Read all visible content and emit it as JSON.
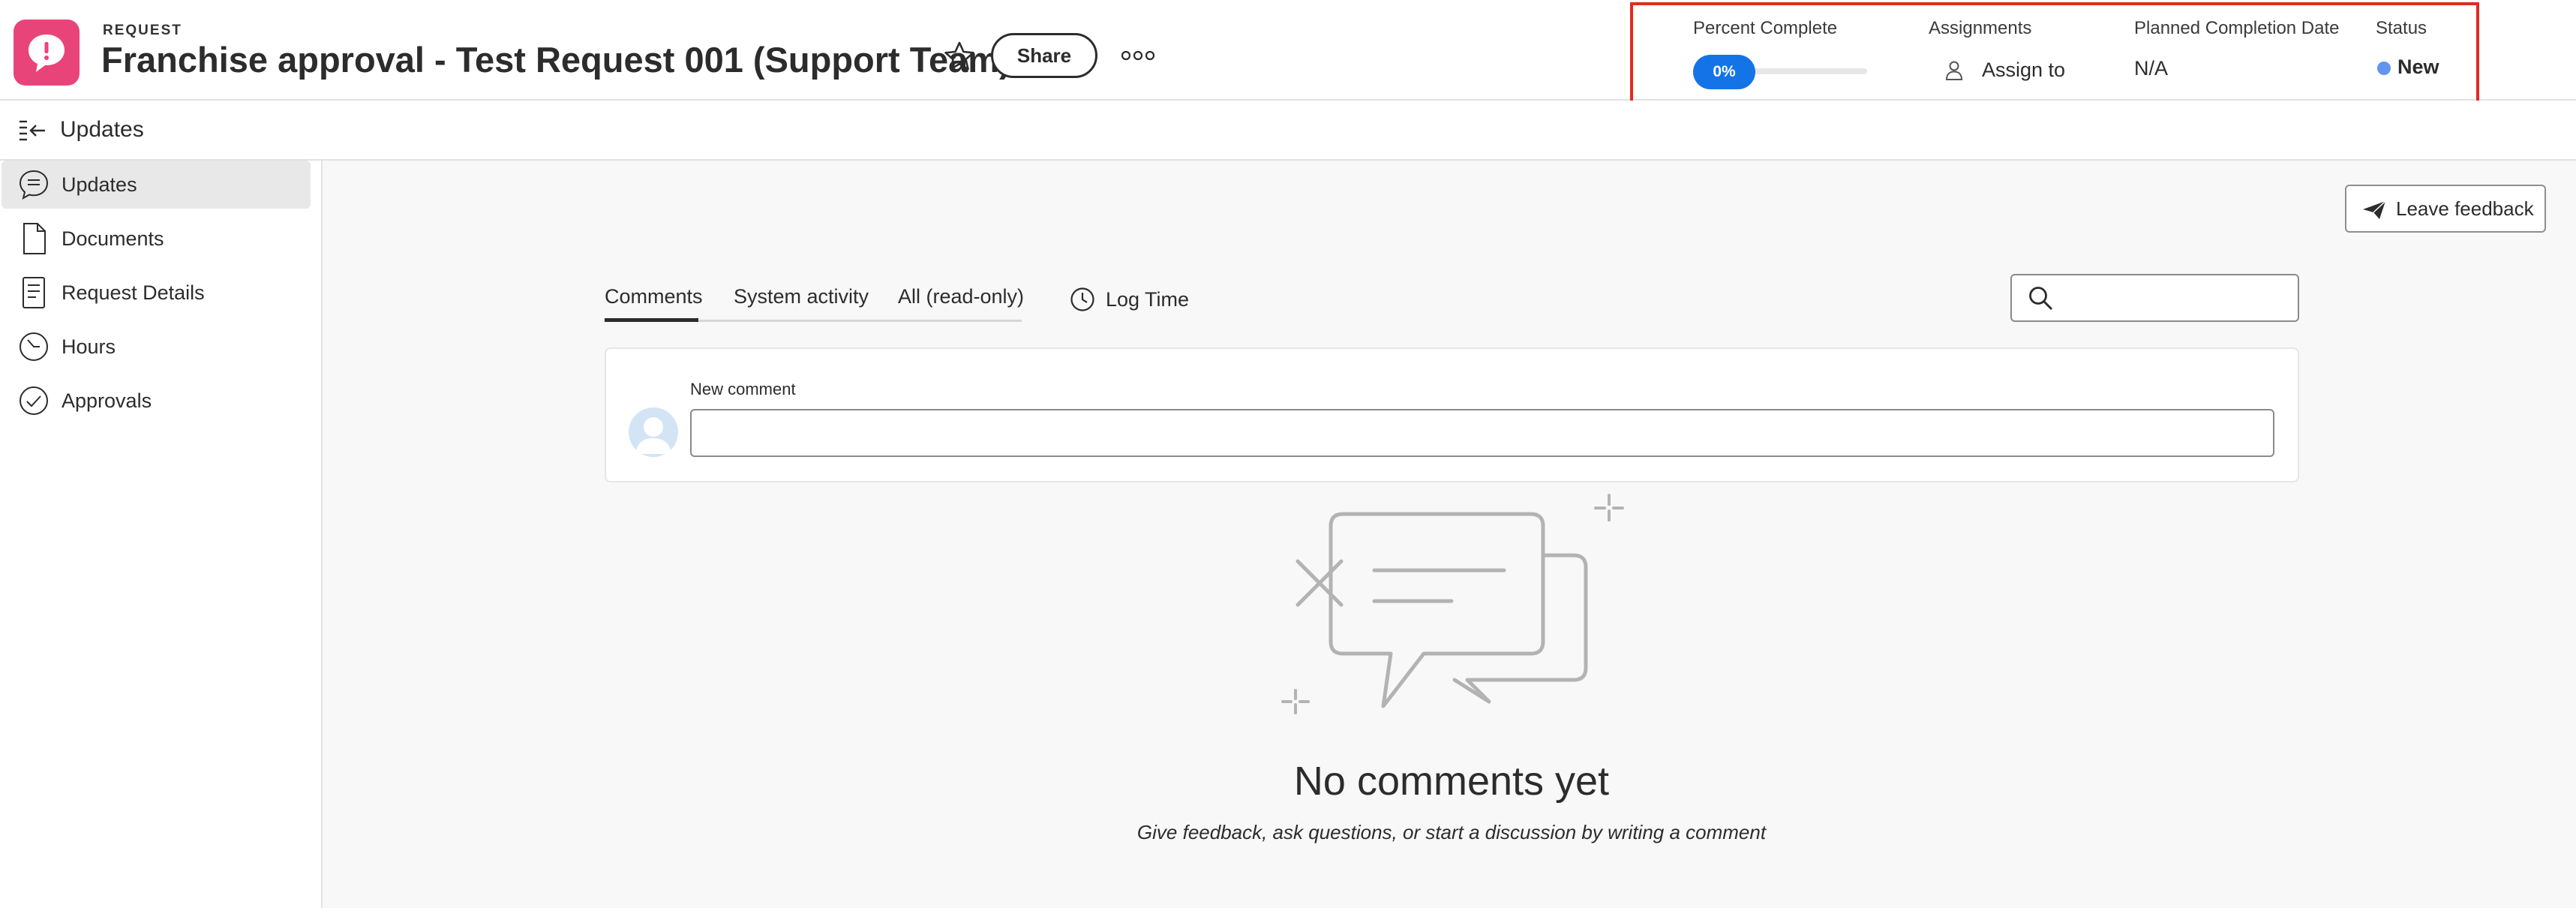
{
  "header": {
    "object_type": "REQUEST",
    "title": "Franchise approval - Test Request 001 (Support Team)",
    "share_label": "Share"
  },
  "summary": {
    "percent_complete_label": "Percent Complete",
    "percent_complete_value": "0%",
    "assignments_label": "Assignments",
    "assign_to_label": "Assign to",
    "planned_completion_label": "Planned Completion Date",
    "planned_completion_value": "N/A",
    "status_label": "Status",
    "status_value": "New",
    "status_color": "#6495ed"
  },
  "subheader": {
    "title": "Updates"
  },
  "sidebar": {
    "items": [
      {
        "label": "Updates",
        "icon": "comment-bubble-icon",
        "active": true
      },
      {
        "label": "Documents",
        "icon": "document-icon",
        "active": false
      },
      {
        "label": "Request Details",
        "icon": "details-icon",
        "active": false
      },
      {
        "label": "Hours",
        "icon": "clock-icon",
        "active": false
      },
      {
        "label": "Approvals",
        "icon": "checkmark-circle-icon",
        "active": false
      }
    ]
  },
  "main": {
    "feedback_label": "Leave feedback",
    "tabs": [
      {
        "label": "Comments",
        "active": true
      },
      {
        "label": "System activity",
        "active": false
      },
      {
        "label": "All (read-only)",
        "active": false
      }
    ],
    "log_time_label": "Log Time",
    "new_comment_label": "New comment",
    "empty_title": "No comments yet",
    "empty_subtitle": "Give feedback, ask questions, or start a discussion by writing a comment"
  },
  "colors": {
    "brand": "#e9447a",
    "accent": "#1473e6",
    "highlight_border": "#e02a20"
  }
}
